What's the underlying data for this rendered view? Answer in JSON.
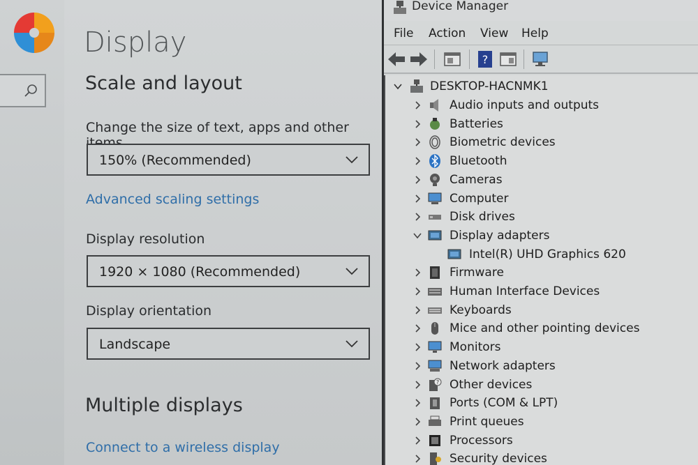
{
  "settings": {
    "page_title": "Display",
    "scale_section": "Scale and layout",
    "scale_label": "Change the size of text, apps and other items",
    "scale_value": "150% (Recommended)",
    "advanced_scaling_link": "Advanced scaling settings",
    "resolution_label": "Display resolution",
    "resolution_value": "1920 × 1080 (Recommended)",
    "orientation_label": "Display orientation",
    "orientation_value": "Landscape",
    "multiple_displays_section": "Multiple displays",
    "wireless_link": "Connect to a wireless display",
    "search_icon": "search-icon",
    "link_color": "#2f6ea8"
  },
  "device_manager": {
    "title": "Device Manager",
    "menu": [
      "File",
      "Action",
      "View",
      "Help"
    ],
    "toolbar": [
      "back-arrow-icon",
      "forward-arrow-icon",
      "properties-icon",
      "help-icon",
      "console-icon",
      "scan-hardware-icon"
    ],
    "root": "DESKTOP-HACNMK1",
    "categories": [
      {
        "label": "Audio inputs and outputs",
        "icon": "speaker-icon",
        "expanded": false
      },
      {
        "label": "Batteries",
        "icon": "battery-icon",
        "expanded": false
      },
      {
        "label": "Biometric devices",
        "icon": "fingerprint-icon",
        "expanded": false
      },
      {
        "label": "Bluetooth",
        "icon": "bluetooth-icon",
        "expanded": false
      },
      {
        "label": "Cameras",
        "icon": "camera-icon",
        "expanded": false
      },
      {
        "label": "Computer",
        "icon": "computer-icon",
        "expanded": false
      },
      {
        "label": "Disk drives",
        "icon": "disk-drive-icon",
        "expanded": false
      },
      {
        "label": "Display adapters",
        "icon": "display-adapter-icon",
        "expanded": true
      },
      {
        "label": "Intel(R) UHD Graphics 620",
        "icon": "display-adapter-icon",
        "child": true
      },
      {
        "label": "Firmware",
        "icon": "firmware-icon",
        "expanded": false
      },
      {
        "label": "Human Interface Devices",
        "icon": "hid-icon",
        "expanded": false
      },
      {
        "label": "Keyboards",
        "icon": "keyboard-icon",
        "expanded": false
      },
      {
        "label": "Mice and other pointing devices",
        "icon": "mouse-icon",
        "expanded": false
      },
      {
        "label": "Monitors",
        "icon": "monitor-icon",
        "expanded": false
      },
      {
        "label": "Network adapters",
        "icon": "network-adapter-icon",
        "expanded": false
      },
      {
        "label": "Other devices",
        "icon": "other-devices-icon",
        "expanded": false
      },
      {
        "label": "Ports (COM & LPT)",
        "icon": "port-icon",
        "expanded": false
      },
      {
        "label": "Print queues",
        "icon": "printer-icon",
        "expanded": false
      },
      {
        "label": "Processors",
        "icon": "processor-icon",
        "expanded": false
      },
      {
        "label": "Security devices",
        "icon": "security-device-icon",
        "expanded": false
      }
    ]
  }
}
